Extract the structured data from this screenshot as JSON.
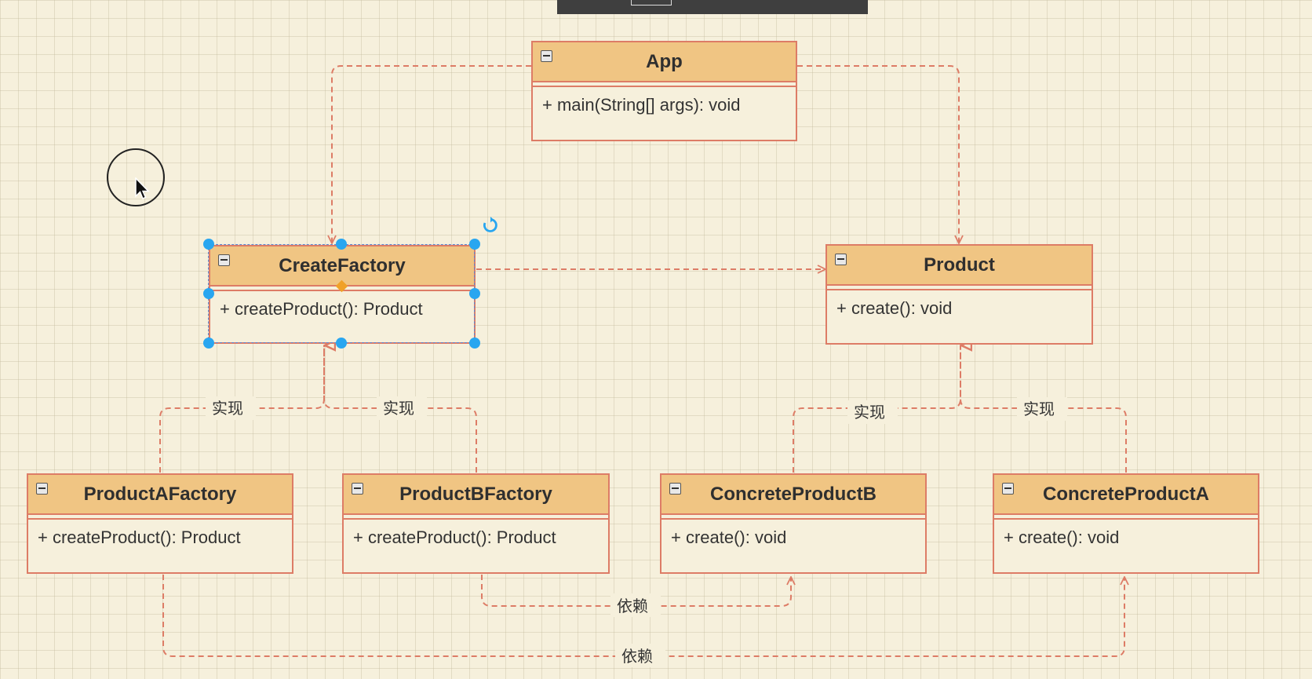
{
  "classes": {
    "app": {
      "name": "App",
      "method": "+ main(String[] args): void"
    },
    "create_factory": {
      "name": "CreateFactory",
      "method": "+ createProduct(): Product"
    },
    "product": {
      "name": "Product",
      "method": "+ create(): void"
    },
    "product_a_factory": {
      "name": "ProductAFactory",
      "method": "+ createProduct(): Product"
    },
    "product_b_factory": {
      "name": "ProductBFactory",
      "method": "+ createProduct(): Product"
    },
    "concrete_product_b": {
      "name": "ConcreteProductB",
      "method": "+ create(): void"
    },
    "concrete_product_a": {
      "name": "ConcreteProductA",
      "method": "+ create(): void"
    }
  },
  "edge_labels": {
    "implements_a_factory": "实现",
    "implements_b_factory": "实现",
    "implements_concrete_b": "实现",
    "implements_concrete_a": "实现",
    "depends_b": "依赖",
    "depends_a": "依赖"
  },
  "colors": {
    "class_header": "#f0c583",
    "class_border": "#dd7c66",
    "edge": "#dd7c66",
    "selection_handle": "#29a6f0",
    "canvas": "#f6f0dc"
  },
  "icons": [
    "collapse-icon",
    "rotate-icon",
    "cursor-arrow-icon"
  ]
}
